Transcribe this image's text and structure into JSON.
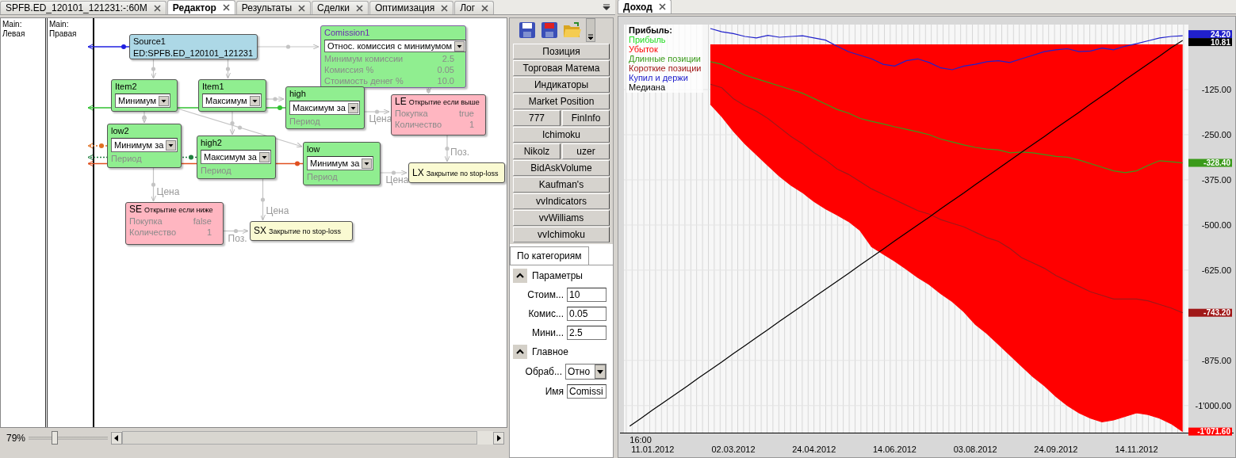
{
  "left_tabs": [
    {
      "label": "SPFB.ED_120101_121231:-:60M",
      "selected": false
    },
    {
      "label": "Редактор",
      "selected": true
    },
    {
      "label": "Результаты",
      "selected": false
    },
    {
      "label": "Сделки",
      "selected": false
    },
    {
      "label": "Оптимизация",
      "selected": false
    },
    {
      "label": "Лог",
      "selected": false
    }
  ],
  "lanes": [
    {
      "title": "Main:",
      "name": "Левая"
    },
    {
      "title": "Main:",
      "name": "Правая"
    }
  ],
  "nodes": [
    {
      "kind": "source",
      "title": "Source1",
      "subtitle": "ED:SPFB.ED_120101_121231"
    },
    {
      "kind": "commission",
      "title": "Comission1",
      "dropdown": "Относ. комиссия с минимумом",
      "params": [
        {
          "label": "Минимум комиссии",
          "value": "2.5"
        },
        {
          "label": "Комиссия %",
          "value": "0.05"
        },
        {
          "label": "Стоимость денег %",
          "value": "10.0"
        }
      ]
    },
    {
      "kind": "indicator",
      "title": "Item2",
      "dropdown": "Минимум"
    },
    {
      "kind": "indicator",
      "title": "Item1",
      "dropdown": "Максимум"
    },
    {
      "kind": "indicator",
      "title": "high",
      "dropdown": "Максимум за",
      "params": [
        {
          "label": "Период"
        }
      ]
    },
    {
      "kind": "entry",
      "title": "LE",
      "caption": "Открытие если выше",
      "params": [
        {
          "label": "Покупка",
          "value": "true"
        },
        {
          "label": "Количество",
          "value": "1"
        }
      ]
    },
    {
      "kind": "indicator",
      "title": "low2",
      "dropdown": "Минимум за",
      "params": [
        {
          "label": "Период"
        }
      ]
    },
    {
      "kind": "indicator",
      "title": "high2",
      "dropdown": "Максимум за",
      "params": [
        {
          "label": "Период"
        }
      ]
    },
    {
      "kind": "indicator",
      "title": "low",
      "dropdown": "Минимум за",
      "params": [
        {
          "label": "Период"
        }
      ]
    },
    {
      "kind": "exit",
      "title": "LX",
      "caption": "Закрытие по stop-loss"
    },
    {
      "kind": "entry",
      "title": "SE",
      "caption": "Открытие если ниже",
      "params": [
        {
          "label": "Покупка",
          "value": "false"
        },
        {
          "label": "Количество",
          "value": "1"
        }
      ]
    },
    {
      "kind": "exit",
      "title": "SX",
      "caption": "Закрытие по stop-loss"
    }
  ],
  "edge_labels": [
    "Цена",
    "Цена",
    "Поз.",
    "Цена",
    "Цена",
    "Поз."
  ],
  "outputs": [
    {
      "color": "#2020e0"
    },
    {
      "color": "#30c030"
    },
    {
      "color": "#e07020"
    },
    {
      "color": "#208040"
    },
    {
      "color": "#e05020"
    }
  ],
  "zoom": {
    "label": "79%",
    "level": 0.33
  },
  "palette": [
    {
      "buttons": [
        "Позиция"
      ]
    },
    {
      "buttons": [
        "Торговая Матема"
      ]
    },
    {
      "buttons": [
        "Индикаторы"
      ]
    },
    {
      "buttons": [
        "Market Position"
      ]
    },
    {
      "buttons": [
        "777",
        "FinInfo"
      ]
    },
    {
      "buttons": [
        "Ichimoku"
      ]
    },
    {
      "buttons": [
        "Nikolz",
        "uzer"
      ]
    },
    {
      "buttons": [
        "BidAskVolume"
      ]
    },
    {
      "buttons": [
        "Kaufman's"
      ]
    },
    {
      "buttons": [
        "vvIndicators"
      ]
    },
    {
      "buttons": [
        "vvWilliams"
      ]
    },
    {
      "buttons": [
        "vvIchimoku"
      ]
    }
  ],
  "property_tabs": [
    {
      "label": "По категориям",
      "selected": true
    }
  ],
  "property_sections": [
    {
      "title": "Параметры",
      "expanded": true,
      "rows": [
        {
          "kind": "field",
          "label": "Стоим...",
          "value": "10"
        },
        {
          "kind": "field",
          "label": "Комис...",
          "value": "0.05"
        },
        {
          "kind": "field",
          "label": "Мини...",
          "value": "2.5"
        }
      ]
    },
    {
      "title": "Главное",
      "expanded": true,
      "rows": [
        {
          "kind": "dropdown",
          "label": "Обраб...",
          "value": "Отно"
        },
        {
          "kind": "field",
          "label": "Имя",
          "value": "Comissi"
        }
      ]
    }
  ],
  "right_tabs": [
    {
      "label": "Доход",
      "selected": true
    }
  ],
  "chart": {
    "time_label": "16:00",
    "chart_data": {
      "type": "line",
      "title": "Прибыль:",
      "categories": [
        null,
        null,
        "11.01.2012",
        null,
        null,
        null,
        null,
        null,
        null,
        "02.03.2012",
        null,
        null,
        null,
        null,
        null,
        null,
        "24.04.2012",
        null,
        null,
        null,
        null,
        null,
        null,
        "14.06.2012",
        null,
        null,
        null,
        null,
        null,
        null,
        "03.08.2012",
        null,
        null,
        null,
        null,
        null,
        null,
        "24.09.2012",
        null,
        null,
        null,
        null,
        null,
        null,
        "14.11.2012",
        null,
        null,
        null,
        null
      ],
      "ylim": [
        -1075,
        55
      ],
      "yticks": [
        {
          "value": -125,
          "label": "-125.00"
        },
        {
          "value": -250,
          "label": "-250.00"
        },
        {
          "value": -375,
          "label": "-375.00"
        },
        {
          "value": -500,
          "label": "-500.00"
        },
        {
          "value": -625,
          "label": "-625.00"
        },
        {
          "value": -875,
          "label": "-875.00"
        },
        {
          "value": -1000,
          "label": "-1'000.00"
        }
      ],
      "series": [
        {
          "name": "Прибыль",
          "color": "#22dd22",
          "values": [
            null,
            null,
            null,
            null,
            null,
            null,
            null,
            null,
            null,
            null,
            null,
            null,
            null,
            null,
            null,
            null,
            null,
            null,
            null,
            null,
            null,
            null,
            null,
            null,
            null,
            null,
            null,
            null,
            null,
            null,
            null,
            null,
            null,
            null,
            null,
            null,
            null,
            null,
            null,
            null,
            null,
            null,
            null,
            null,
            null,
            null,
            null,
            null,
            null
          ]
        },
        {
          "name": "Убыток",
          "color": "#ff0000",
          "type": "area",
          "values": [
            null,
            null,
            null,
            null,
            null,
            null,
            null,
            -165,
            -200,
            -240,
            -275,
            -305,
            -335,
            -365,
            -390,
            -410,
            -435,
            -455,
            -472,
            -490,
            -515,
            -560,
            -580,
            -600,
            -622,
            -645,
            -665,
            -690,
            -712,
            -740,
            -775,
            -800,
            -830,
            -860,
            -890,
            -920,
            -945,
            -975,
            -1000,
            -1020,
            -1035,
            -1045,
            -1040,
            -1030,
            -1020,
            -1025,
            -1035,
            -1050,
            -1072
          ]
        },
        {
          "name": "Длинные позиции",
          "color": "#3a9a1a",
          "values": [
            null,
            null,
            null,
            null,
            null,
            null,
            null,
            -48,
            -55,
            -70,
            -85,
            -95,
            -105,
            -115,
            -125,
            -135,
            -150,
            -165,
            -180,
            -190,
            -205,
            -213,
            -220,
            -228,
            -235,
            -242,
            -250,
            -262,
            -270,
            -278,
            -285,
            -290,
            -292,
            -300,
            -298,
            -300,
            -305,
            -310,
            -312,
            -320,
            -330,
            -340,
            -350,
            -355,
            -350,
            -335,
            -322,
            -325,
            -328
          ]
        },
        {
          "name": "Короткие позиции",
          "color": "#a01818",
          "values": [
            null,
            null,
            null,
            null,
            null,
            null,
            null,
            -110,
            -120,
            -150,
            -170,
            -185,
            -205,
            -230,
            -255,
            -275,
            -300,
            -320,
            -345,
            -360,
            -380,
            -400,
            -415,
            -430,
            -445,
            -460,
            -470,
            -485,
            -495,
            -505,
            -520,
            -535,
            -545,
            -565,
            -590,
            -605,
            -620,
            -640,
            -655,
            -670,
            -685,
            -695,
            -705,
            -705,
            -705,
            -710,
            -720,
            -730,
            -743
          ]
        },
        {
          "name": "Купил и держи",
          "color": "#2020cc",
          "values": [
            null,
            null,
            null,
            null,
            null,
            null,
            null,
            44,
            35,
            30,
            22,
            18,
            25,
            20,
            22,
            24,
            18,
            12,
            -5,
            -20,
            -30,
            -40,
            -55,
            -60,
            -45,
            -40,
            -50,
            -65,
            -70,
            -60,
            -55,
            -48,
            -45,
            -50,
            -40,
            -30,
            -20,
            -15,
            -12,
            -20,
            -18,
            -10,
            -15,
            -5,
            2,
            10,
            18,
            22,
            24
          ]
        },
        {
          "name": "Медиана",
          "color": "#000000",
          "values": [
            -1057,
            -1035,
            -1012,
            -990,
            -968,
            -946,
            -923,
            -901,
            -879,
            -856,
            -834,
            -812,
            -790,
            -767,
            -745,
            -723,
            -700,
            -678,
            -656,
            -634,
            -611,
            -589,
            -567,
            -544,
            -522,
            -500,
            -478,
            -455,
            -433,
            -411,
            -388,
            -366,
            -344,
            -321,
            -299,
            -277,
            -255,
            -232,
            -210,
            -188,
            -165,
            -143,
            -121,
            -98,
            -76,
            -54,
            -32,
            -9,
            11
          ]
        }
      ],
      "grid": true,
      "annotations": [
        "24.20",
        "10.81",
        "-328.40",
        "-743.20",
        "-1'071.60"
      ]
    }
  }
}
